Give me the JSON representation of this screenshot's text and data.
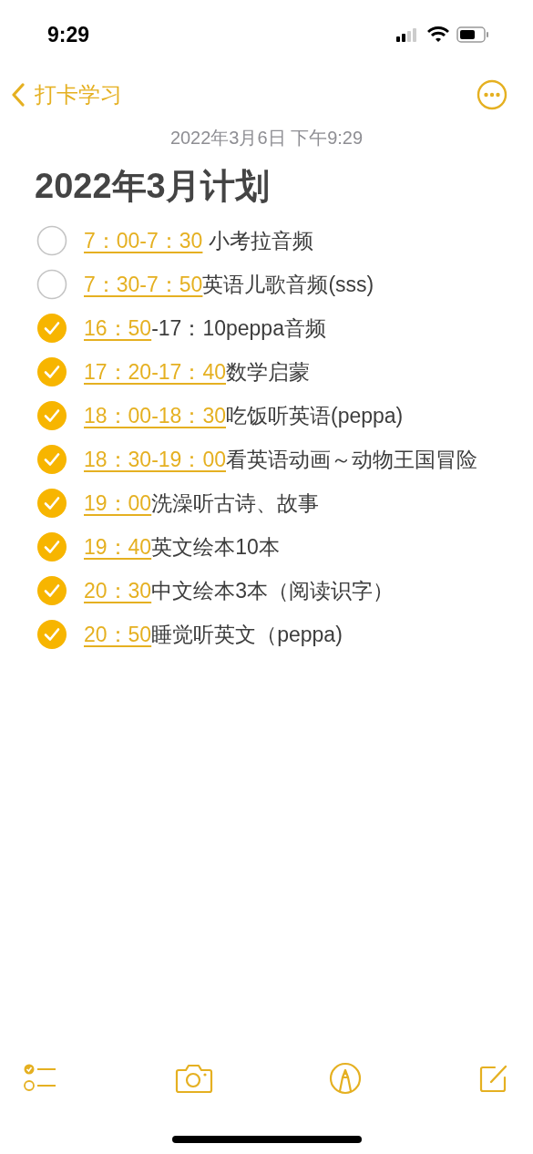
{
  "status_bar": {
    "time": "9:29"
  },
  "nav": {
    "back_label": "打卡学习"
  },
  "note": {
    "date": "2022年3月6日 下午9:29",
    "title": "2022年3月计划",
    "items": [
      {
        "time": "7：00-7：30",
        "text": " 小考拉音频",
        "checked": false
      },
      {
        "time": "7：30-7：50",
        "text": "英语儿歌音频(sss)",
        "checked": false
      },
      {
        "time": "16：50",
        "text": "-17：10peppa音频",
        "checked": true
      },
      {
        "time": "17：20-17：40",
        "text": "数学启蒙",
        "checked": true
      },
      {
        "time": "18：00-18：30",
        "text": "吃饭听英语(peppa)",
        "checked": true
      },
      {
        "time": "18：30-19：00",
        "text": "看英语动画～动物王国冒险",
        "checked": true
      },
      {
        "time": "19：00",
        "text": "洗澡听古诗、故事",
        "checked": true
      },
      {
        "time": "19：40",
        "text": "英文绘本10本",
        "checked": true
      },
      {
        "time": "20：30",
        "text": "中文绘本3本（阅读识字）",
        "checked": true
      },
      {
        "time": "20：50",
        "text": "睡觉听英文（peppa)",
        "checked": true
      }
    ]
  }
}
